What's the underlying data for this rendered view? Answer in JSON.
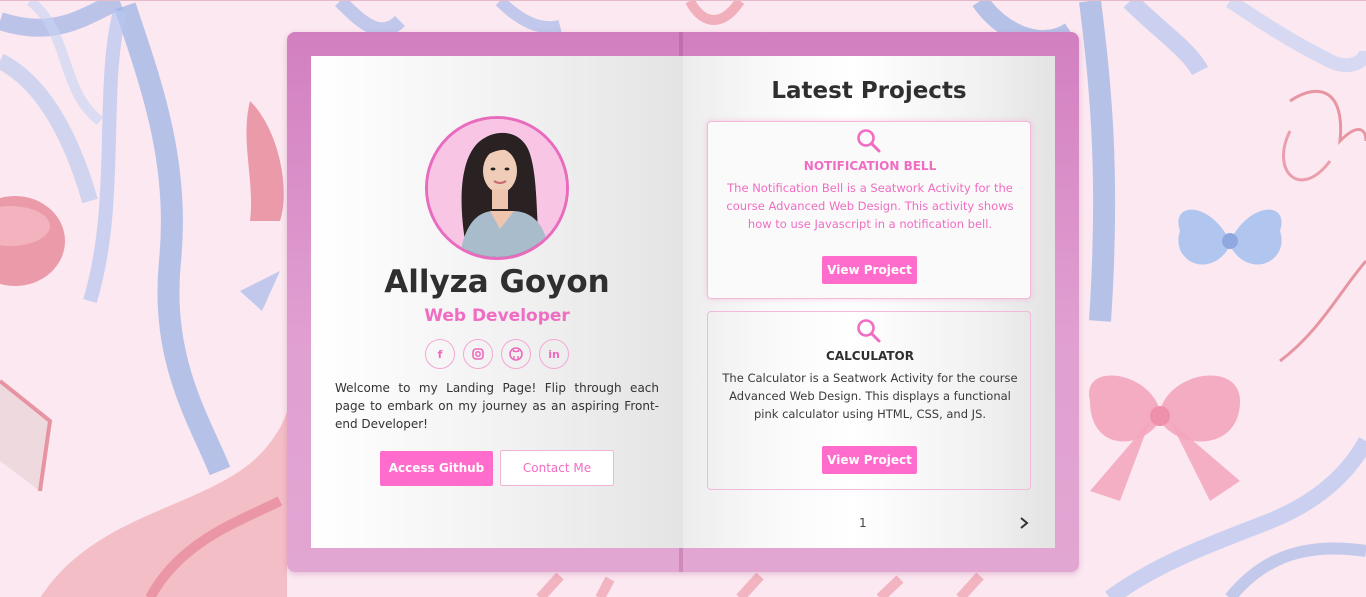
{
  "profile": {
    "name": "Allyza Goyon",
    "role": "Web Developer",
    "intro": "Welcome to my Landing Page! Flip through each page to embark on my journey as an aspiring Front-end Developer!",
    "socials": [
      {
        "icon": "facebook-icon",
        "glyph": "f"
      },
      {
        "icon": "instagram-icon",
        "glyph": "◘"
      },
      {
        "icon": "github-icon",
        "glyph": "●"
      },
      {
        "icon": "linkedin-icon",
        "glyph": "in"
      }
    ],
    "primary_button": "Access Github",
    "secondary_button": "Contact Me"
  },
  "projects": {
    "title": "Latest Projects",
    "items": [
      {
        "name": "NOTIFICATION BELL",
        "description": "The Notification Bell is a Seatwork Activity for the course Advanced Web Design. This activity shows how to use Javascript in a notification bell.",
        "button": "View Project",
        "highlighted": true
      },
      {
        "name": "CALCULATOR",
        "description": "The Calculator is a Seatwork Activity for the course Advanced Web Design. This displays a functional pink calculator using HTML, CSS, and JS.",
        "button": "View Project",
        "highlighted": false
      }
    ],
    "page_number": "1"
  },
  "colors": {
    "accent": "#ff6ccb",
    "accent_text": "#f06dc3",
    "book": "#d27fc0",
    "text_dark": "#2f2f2f"
  }
}
